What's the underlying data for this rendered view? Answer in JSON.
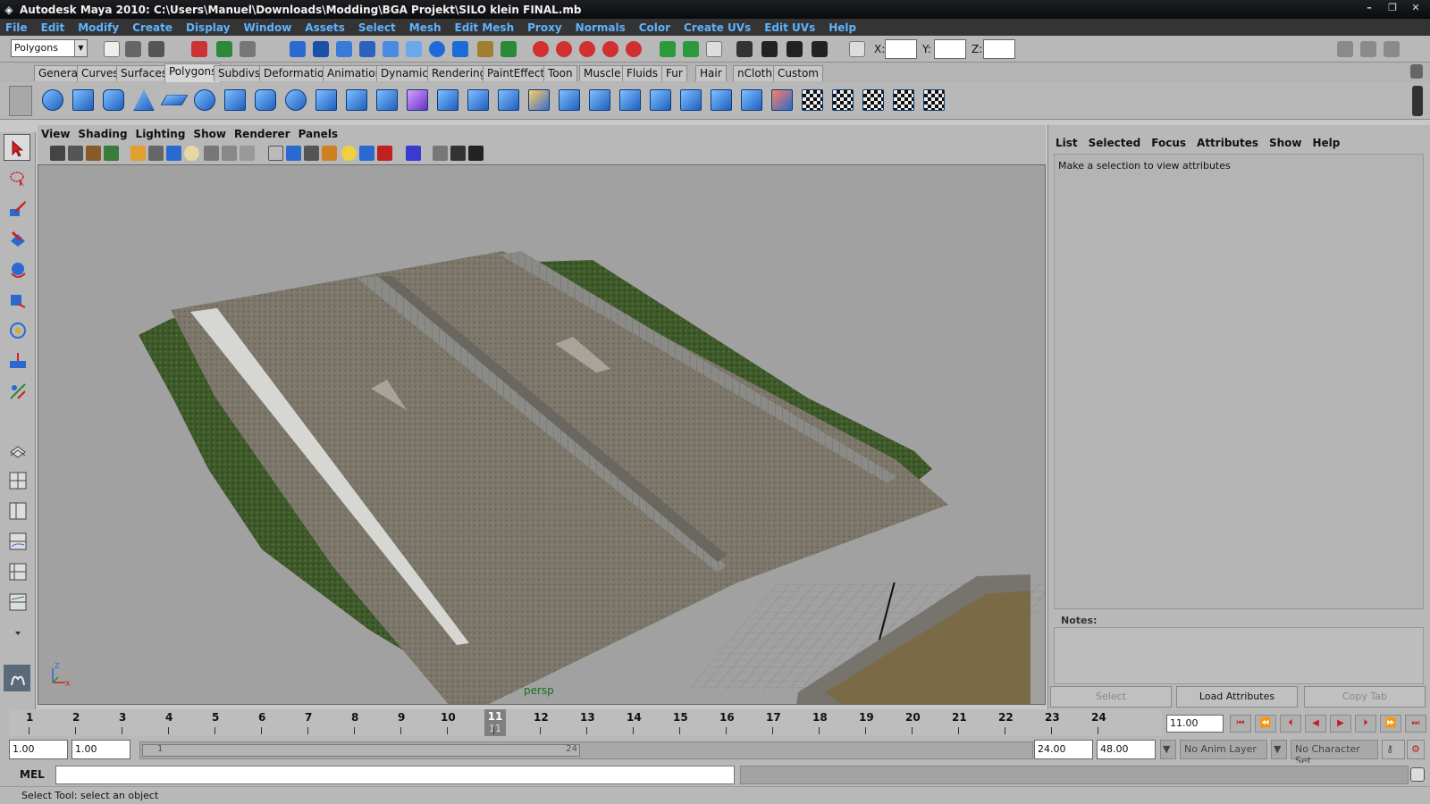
{
  "window": {
    "title": "Autodesk Maya 2010: C:\\Users\\Manuel\\Downloads\\Modding\\BGA Projekt\\SILO klein FINAL.mb",
    "controls": [
      "–",
      "❐",
      "✕"
    ]
  },
  "menubar": [
    "File",
    "Edit",
    "Modify",
    "Create",
    "Display",
    "Window",
    "Assets",
    "Select",
    "Mesh",
    "Edit Mesh",
    "Proxy",
    "Normals",
    "Color",
    "Create UVs",
    "Edit UVs",
    "Help"
  ],
  "statusline": {
    "mode": "Polygons",
    "x_label": "X:",
    "y_label": "Y:",
    "z_label": "Z:",
    "x_value": "",
    "y_value": "",
    "z_value": ""
  },
  "shelf_tabs": [
    "General",
    "Curves",
    "Surfaces",
    "Polygons",
    "Subdivs",
    "Deformation",
    "Animation",
    "Dynamics",
    "Rendering",
    "PaintEffects",
    "Toon",
    "Muscle",
    "Fluids",
    "Fur",
    "Hair",
    "nCloth",
    "Custom"
  ],
  "active_shelf_tab": "Polygons",
  "panel_menu": [
    "View",
    "Shading",
    "Lighting",
    "Show",
    "Renderer",
    "Panels"
  ],
  "viewport": {
    "camera": "persp",
    "axis_z": "Z",
    "axis_x": "X"
  },
  "attribute_editor": {
    "menu": [
      "List",
      "Selected",
      "Focus",
      "Attributes",
      "Show",
      "Help"
    ],
    "hint": "Make a selection to view attributes",
    "notes_label": "Notes:",
    "buttons": [
      "Select",
      "Load Attributes",
      "Copy Tab"
    ]
  },
  "timeline": {
    "frames": [
      "1",
      "2",
      "3",
      "4",
      "5",
      "6",
      "7",
      "8",
      "9",
      "10",
      "11",
      "12",
      "13",
      "14",
      "15",
      "16",
      "17",
      "18",
      "19",
      "20",
      "21",
      "22",
      "23",
      "24"
    ],
    "current_frame": "11",
    "current_time": "11.00"
  },
  "range": {
    "start_time": "1.00",
    "playback_start": "1.00",
    "range_start_label": "1",
    "range_end_label": "24",
    "playback_end": "24.00",
    "end_time": "48.00",
    "anim_layer": "No Anim Layer",
    "character_set": "No Character Set"
  },
  "command_line": {
    "label": "MEL",
    "value": ""
  },
  "help_line": "Select Tool: select an object",
  "colors": {
    "menu_text": "#5db3ff",
    "ui_gray": "#b8b8b8",
    "viewport_bg": "#a1a1a1"
  }
}
